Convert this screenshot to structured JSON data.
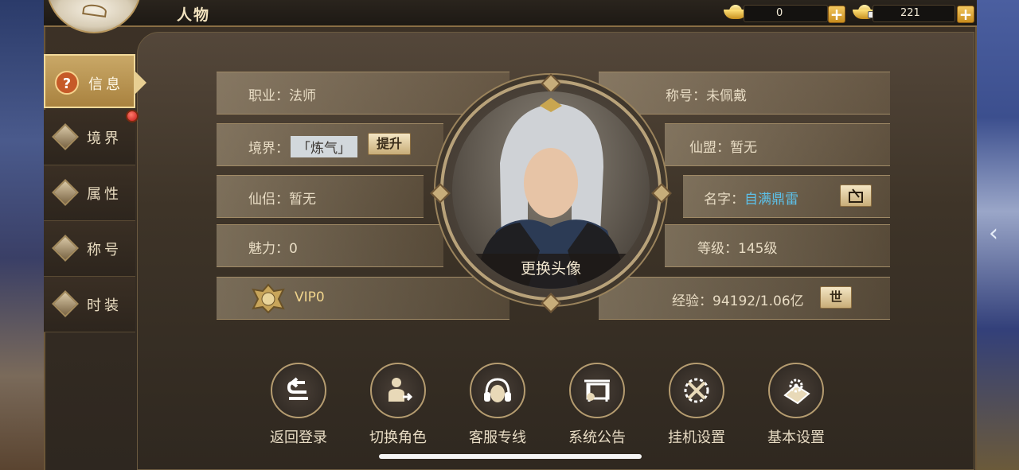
{
  "header": {
    "title": "人物",
    "gold": "0",
    "bound_gold": "221"
  },
  "tabs": [
    {
      "label": "信息",
      "icon": "question-icon"
    },
    {
      "label": "境界",
      "icon": "realm-icon"
    },
    {
      "label": "属性",
      "icon": "attribute-icon"
    },
    {
      "label": "称号",
      "icon": "title-icon"
    },
    {
      "label": "时装",
      "icon": "costume-icon"
    }
  ],
  "info": {
    "profession": "职业：法师",
    "realm_prefix": "境界：",
    "realm_value": "「炼气」",
    "realm_button": "提升",
    "partner": "仙侣：暂无",
    "charm": "魅力：0",
    "vip": "VIP0",
    "title_text": "称号：未佩戴",
    "alliance": "仙盟：暂无",
    "name_prefix": "名字：",
    "name_value": "自满鼎雷",
    "level": "等级：145级",
    "exp": "经验：94192/1.06亿",
    "exp_button": "世"
  },
  "portrait": {
    "change_label": "更换头像"
  },
  "actions": [
    {
      "label": "返回登录",
      "icon": "return-login-icon"
    },
    {
      "label": "切换角色",
      "icon": "switch-character-icon"
    },
    {
      "label": "客服专线",
      "icon": "headset-icon"
    },
    {
      "label": "系统公告",
      "icon": "announcement-icon"
    },
    {
      "label": "挂机设置",
      "icon": "auto-battle-icon"
    },
    {
      "label": "基本设置",
      "icon": "settings-icon"
    }
  ],
  "colors": {
    "accent_gold": "#c9a867",
    "name_blue": "#5dc0e8",
    "badge_red": "#c31818"
  }
}
